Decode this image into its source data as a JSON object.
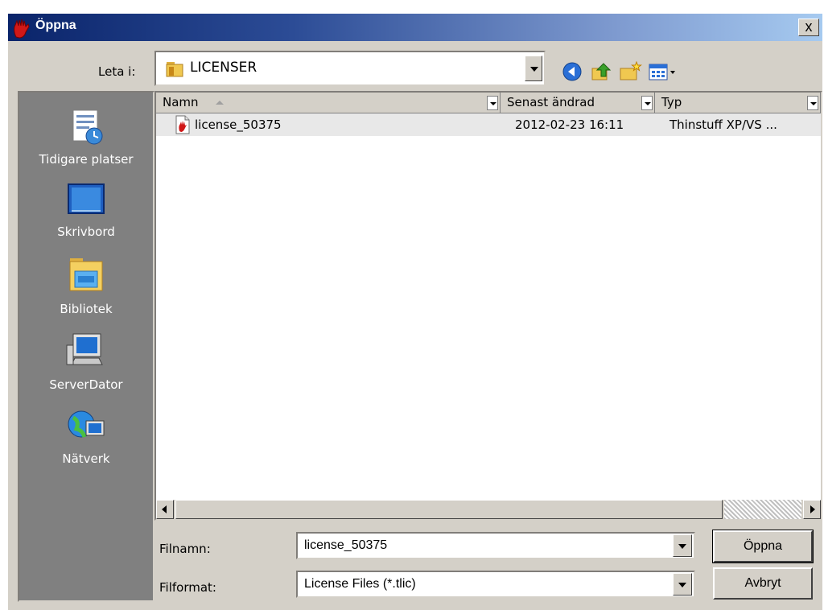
{
  "window": {
    "title": "Öppna",
    "close_label": "x"
  },
  "lookin": {
    "label": "Leta i:",
    "value": "LICENSER"
  },
  "toolbar": {
    "icons": [
      "back-icon",
      "up-folder-icon",
      "new-folder-icon",
      "view-menu-icon"
    ]
  },
  "places": [
    {
      "label": "Tidigare platser",
      "icon": "recent-places-icon"
    },
    {
      "label": "Skrivbord",
      "icon": "desktop-icon"
    },
    {
      "label": "Bibliotek",
      "icon": "libraries-icon"
    },
    {
      "label": "ServerDator",
      "icon": "computer-icon"
    },
    {
      "label": "Nätverk",
      "icon": "network-icon"
    }
  ],
  "columns": {
    "name": "Namn",
    "modified": "Senast ändrad",
    "type": "Typ"
  },
  "files": [
    {
      "name": "license_50375",
      "modified": "2012-02-23 16:11",
      "type": "Thinstuff XP/VS ..."
    }
  ],
  "filename": {
    "label": "Filnamn:",
    "value": "license_50375"
  },
  "filetype": {
    "label": "Filformat:",
    "value": "License Files (*.tlic)"
  },
  "buttons": {
    "open": "Öppna",
    "cancel": "Avbryt"
  }
}
